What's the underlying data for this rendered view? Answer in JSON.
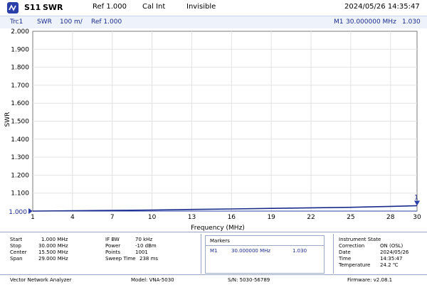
{
  "header": {
    "logo_icon": "vna-logo-icon",
    "param": "S11",
    "format": "SWR",
    "ref": "Ref  1.000",
    "cal": "Cal Int",
    "visibility": "Invisible",
    "datetime": "2024/05/26  14:35:47"
  },
  "trace_bar": {
    "trace": "Trc1",
    "format": "SWR",
    "scale": "100  m/",
    "ref": "Ref  1.000",
    "marker_name": "M1",
    "marker_freq": "30.000000  MHz",
    "marker_value": "1.030"
  },
  "chart_data": {
    "type": "line",
    "xlabel": "Frequency (MHz)",
    "ylabel": "SWR",
    "xlim": [
      1,
      30
    ],
    "ylim": [
      1.0,
      2.0
    ],
    "x_ticks": [
      1,
      4,
      7,
      10,
      13,
      16,
      19,
      22,
      25,
      28,
      30
    ],
    "y_ticks": [
      "1.000",
      "1.100",
      "1.200",
      "1.300",
      "1.400",
      "1.500",
      "1.600",
      "1.700",
      "1.800",
      "1.900",
      "2.000"
    ],
    "grid": true,
    "reference_value": 1.0,
    "reference_label": "1.000",
    "series": [
      {
        "color": "#1a2a8a",
        "x": [
          1,
          4,
          7,
          10,
          13,
          16,
          19,
          22,
          25,
          28,
          30
        ],
        "values": [
          1.0,
          1.002,
          1.004,
          1.006,
          1.009,
          1.012,
          1.015,
          1.018,
          1.021,
          1.026,
          1.03
        ]
      }
    ],
    "marker": {
      "label": "1",
      "x": 30,
      "y": 1.03
    }
  },
  "settings": {
    "start_label": "Start",
    "start_value": "1.000  MHz",
    "stop_label": "Stop",
    "stop_value": "30.000  MHz",
    "center_label": "Center",
    "center_value": "15.500  MHz",
    "span_label": "Span",
    "span_value": "29.000  MHz",
    "ifbw_label": "IF BW",
    "ifbw_value": "70  kHz",
    "power_label": "Power",
    "power_value": "-10  dBm",
    "points_label": "Points",
    "points_value": "1001",
    "sweep_label": "Sweep Time",
    "sweep_value": "238  ms"
  },
  "markers_panel": {
    "title": "Markers",
    "m1_name": "M1",
    "m1_freq": "30.000000  MHz",
    "m1_value": "1.030"
  },
  "instrument_state": {
    "title": "Instrument State",
    "correction_label": "Correction",
    "correction_value": "ON  (OSL)",
    "date_label": "Date",
    "date_value": "2024/05/26",
    "time_label": "Time",
    "time_value": "14:35:47",
    "temp_label": "Temperature",
    "temp_value": "24.2  ℃"
  },
  "footer": {
    "device": "Vector Network Analyzer",
    "model": "Model:  VNA-5030",
    "serial": "S/N:  5030-56789",
    "firmware": "Firmware:  v2.08.1"
  }
}
